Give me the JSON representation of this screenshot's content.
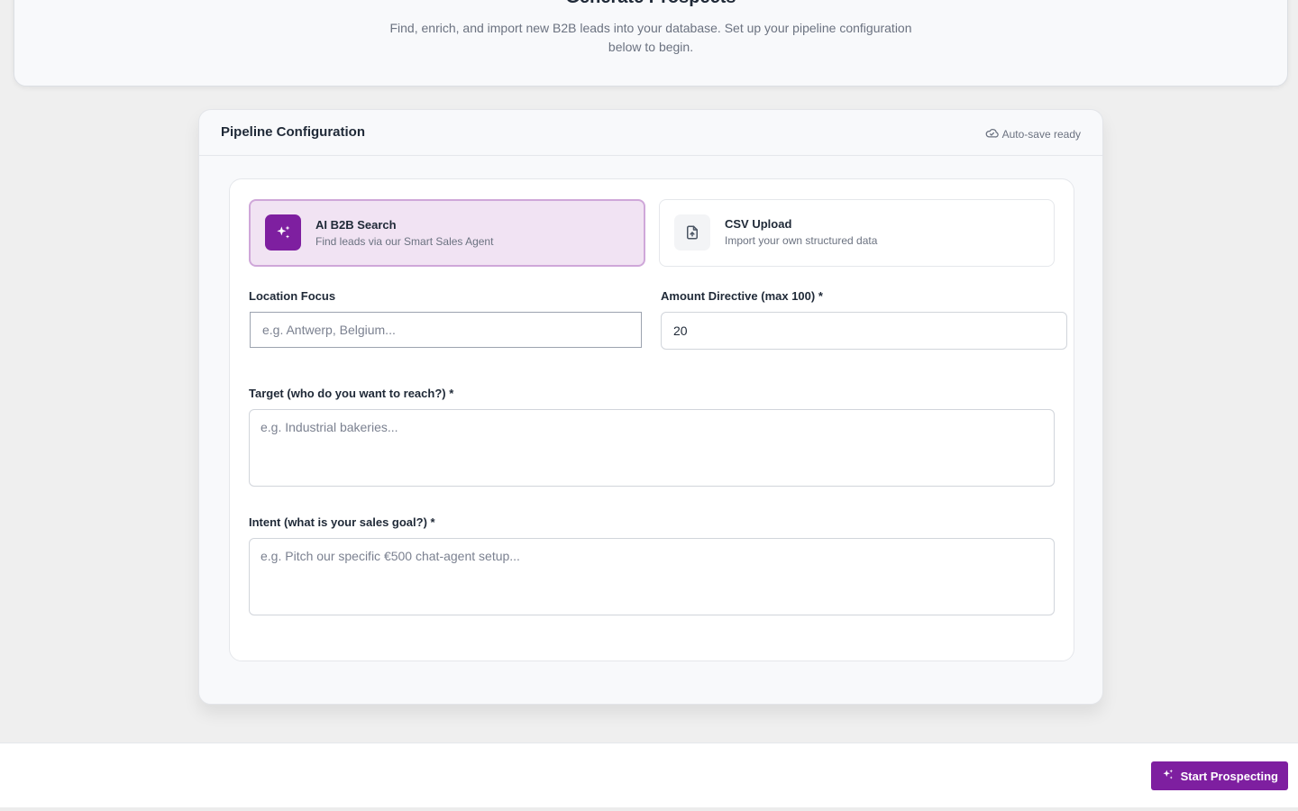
{
  "hero": {
    "title": "Generate Prospects",
    "description": "Find, enrich, and import new B2B leads into your database. Set up your pipeline configuration below to begin."
  },
  "config": {
    "title": "Pipeline Configuration",
    "autosave_label": "Auto-save ready",
    "autosave_icon": "cloud-check-icon"
  },
  "modes": [
    {
      "title": "AI B2B Search",
      "subtitle": "Find leads via our Smart Sales Agent",
      "icon": "sparkles-icon",
      "selected": true
    },
    {
      "title": "CSV Upload",
      "subtitle": "Import your own structured data",
      "icon": "file-upload-icon",
      "selected": false
    }
  ],
  "fields": {
    "location": {
      "label": "Location Focus",
      "placeholder": "e.g. Antwerp, Belgium...",
      "value": ""
    },
    "amount": {
      "label": "Amount Directive (max 100) *",
      "placeholder": "",
      "value": "20"
    },
    "target": {
      "label": "Target (who do you want to reach?) *",
      "placeholder": "e.g. Industrial bakeries..."
    },
    "intent": {
      "label": "Intent (what is your sales goal?) *",
      "placeholder": "e.g. Pitch our specific €500 chat-agent setup..."
    }
  },
  "footer": {
    "start_label": "Start Prospecting",
    "start_icon": "sparkles-icon"
  },
  "colors": {
    "accent": "#7e1fa0",
    "accent_light": "#f1e3f3"
  }
}
